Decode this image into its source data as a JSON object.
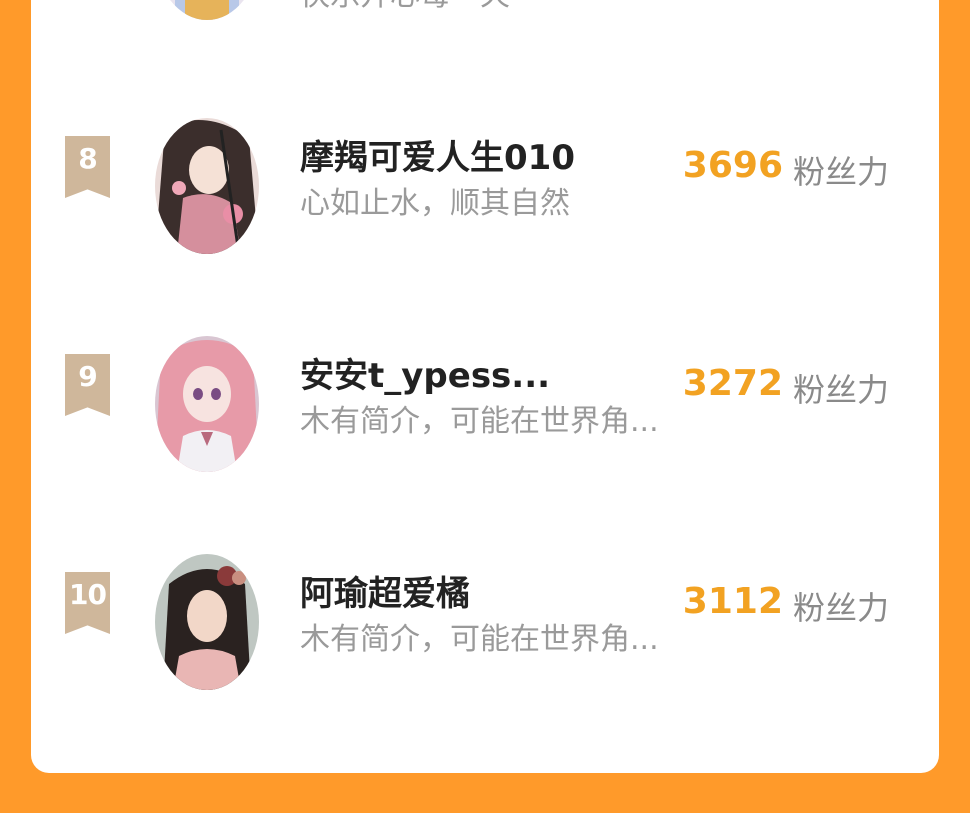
{
  "partial_row": {
    "bio": "快乐开心每一天"
  },
  "rows": [
    {
      "rank": "8",
      "name": "摩羯可爱人生010",
      "bio": "心如止水，顺其自然",
      "score": "3696",
      "unit": "粉丝力"
    },
    {
      "rank": "9",
      "name": "安安t_ypess...",
      "bio": "木有简介，可能在世界角...",
      "score": "3272",
      "unit": "粉丝力"
    },
    {
      "rank": "10",
      "name": "阿瑜超爱橘",
      "bio": "木有简介，可能在世界角...",
      "score": "3112",
      "unit": "粉丝力"
    }
  ],
  "colors": {
    "background": "#ff9a2a",
    "score": "#f2a222",
    "rank_badge": "#cfb79b"
  }
}
